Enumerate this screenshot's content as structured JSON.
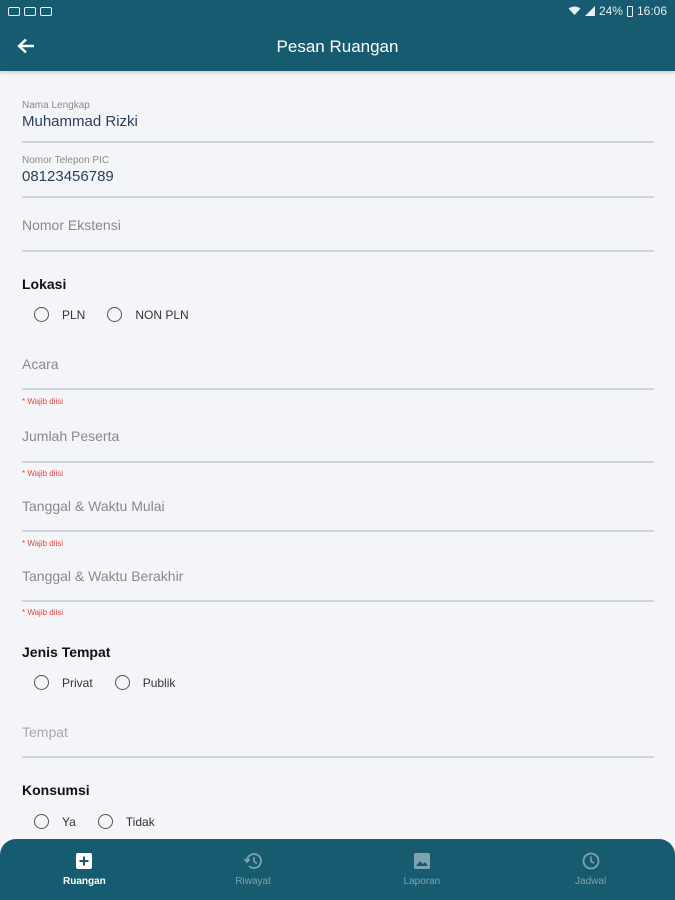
{
  "status_bar": {
    "battery": "24%",
    "time": "16:06"
  },
  "app_bar": {
    "title": "Pesan Ruangan"
  },
  "form": {
    "nama": {
      "label": "Nama Lengkap",
      "value": "Muhammad Rizki"
    },
    "telepon": {
      "label": "Nomor Telepon PIC",
      "value": "08123456789"
    },
    "ekstensi": {
      "placeholder": "Nomor Ekstensi"
    },
    "lokasi": {
      "title": "Lokasi",
      "options": [
        "PLN",
        "NON PLN"
      ]
    },
    "acara": {
      "placeholder": "Acara",
      "error": "* Wajib diisi"
    },
    "jumlah": {
      "placeholder": "Jumlah Peserta",
      "error": "* Wajib diisi"
    },
    "mulai": {
      "placeholder": "Tanggal & Waktu Mulai",
      "error": "* Wajib diisi"
    },
    "berakhir": {
      "placeholder": "Tanggal & Waktu Berakhir",
      "error": "* Wajib diisi"
    },
    "jenis_tempat": {
      "title": "Jenis Tempat",
      "options": [
        "Privat",
        "Publik"
      ]
    },
    "tempat": {
      "placeholder": "Tempat"
    },
    "konsumsi": {
      "title": "Konsumsi",
      "options": [
        "Ya",
        "Tidak"
      ]
    }
  },
  "bottom_nav": {
    "items": [
      {
        "label": "Ruangan",
        "icon": "add-box-icon",
        "active": true
      },
      {
        "label": "Riwayat",
        "icon": "history-icon",
        "active": false
      },
      {
        "label": "Laporan",
        "icon": "image-icon",
        "active": false
      },
      {
        "label": "Jadwal",
        "icon": "clock-icon",
        "active": false
      }
    ]
  },
  "colors": {
    "primary": "#165b6f",
    "background": "#f4f5f8",
    "error": "#e04545",
    "inactive": "#7ea3ae"
  }
}
